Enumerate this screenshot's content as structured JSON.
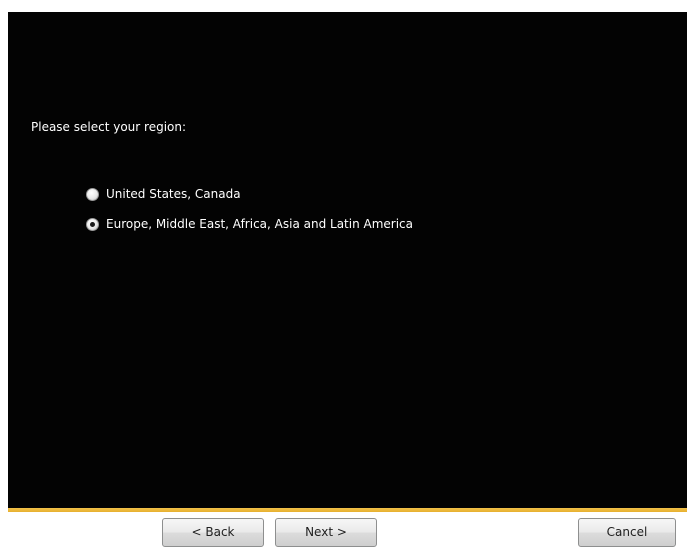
{
  "wizard": {
    "prompt": "Please select your region:",
    "regions": [
      {
        "label": "United States, Canada",
        "selected": false
      },
      {
        "label": "Europe, Middle East, Africa, Asia and Latin America",
        "selected": true
      }
    ]
  },
  "buttons": {
    "back_label": "< Back",
    "next_label": "Next >",
    "cancel_label": "Cancel"
  },
  "colors": {
    "panel_background": "#030303",
    "accent_line": "#e7b02e",
    "text": "#ffffff"
  }
}
